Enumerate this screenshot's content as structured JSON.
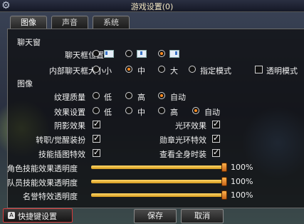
{
  "window": {
    "title": "游戏设置(0)"
  },
  "tabs": [
    {
      "label": "图像"
    },
    {
      "label": "声音"
    },
    {
      "label": "系统"
    }
  ],
  "chat_section": {
    "heading": "聊天窗",
    "position_label": "聊天框位置",
    "position_selected": 3,
    "size_label": "内部聊天框大小",
    "size_options": [
      "小",
      "中",
      "大",
      "指定模式"
    ],
    "size_selected": "中",
    "transparent_label": "透明模式",
    "transparent_checked": false
  },
  "image_section": {
    "heading": "图像",
    "texture_label": "纹理质量",
    "texture_options": [
      "低",
      "高",
      "自动"
    ],
    "texture_selected": "自动",
    "effect_label": "效果设置",
    "effect_options": [
      "低",
      "中",
      "高",
      "自动"
    ],
    "effect_selected": "自动",
    "checks": [
      {
        "label": "阴影效果",
        "checked": true
      },
      {
        "label": "光环效果",
        "checked": true
      },
      {
        "label": "转职/觉醒装扮",
        "checked": true
      },
      {
        "label": "勋章光环特效",
        "checked": true
      },
      {
        "label": "技能插图特效",
        "checked": true
      },
      {
        "label": "查看全身时装",
        "checked": true
      }
    ],
    "sliders": [
      {
        "label": "角色技能效果透明度",
        "value": 100,
        "text": "100%"
      },
      {
        "label": "队员技能效果透明度",
        "value": 100,
        "text": "100%"
      },
      {
        "label": "名誉特效透明度",
        "value": 100,
        "text": "100%"
      }
    ]
  },
  "footer": {
    "shortcut_label": "快捷键设置",
    "shortcut_icon": "A",
    "save_label": "保存",
    "cancel_label": "取消"
  },
  "colors": {
    "accent": "#ff8a1e",
    "slider": "#e0a82a",
    "highlight_border": "#d43a3a"
  }
}
